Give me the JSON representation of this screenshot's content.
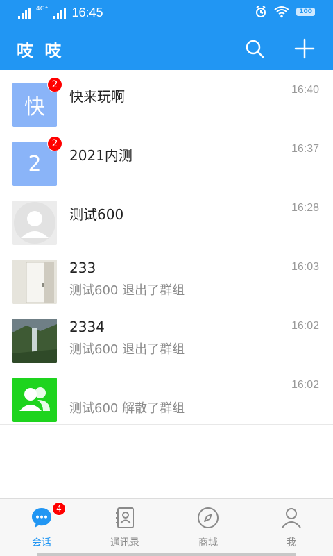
{
  "status": {
    "time": "16:45",
    "network_label": "4G⁺",
    "battery": "100"
  },
  "header": {
    "title": "吱 吱",
    "search_icon": "search-icon",
    "add_icon": "plus-icon"
  },
  "chats": [
    {
      "avatar_text": "快",
      "avatar_color": "#8ab4f8",
      "badge": "2",
      "name": "快来玩啊",
      "subtitle": "",
      "time": "16:40"
    },
    {
      "avatar_text": "2",
      "avatar_color": "#8ab4f8",
      "badge": "2",
      "name": "2021内测",
      "subtitle": "",
      "time": "16:37"
    },
    {
      "avatar_text": "",
      "avatar_color": "#e8e8e8",
      "badge": "",
      "name": "测试600",
      "subtitle": "",
      "time": "16:28"
    },
    {
      "avatar_text": "",
      "avatar_color": "#d8d8d0",
      "badge": "",
      "name": "233",
      "subtitle": "测试600 退出了群组",
      "time": "16:03"
    },
    {
      "avatar_text": "",
      "avatar_color": "#3a4a3a",
      "badge": "",
      "name": "2334",
      "subtitle": "测试600 退出了群组",
      "time": "16:02"
    },
    {
      "avatar_text": "",
      "avatar_color": "#1ed41e",
      "badge": "",
      "name": "",
      "subtitle": "测试600 解散了群组",
      "time": "16:02"
    }
  ],
  "tabs": [
    {
      "label": "会话",
      "icon": "chat-icon",
      "badge": "4"
    },
    {
      "label": "通讯录",
      "icon": "contacts-icon",
      "badge": ""
    },
    {
      "label": "商城",
      "icon": "compass-icon",
      "badge": ""
    },
    {
      "label": "我",
      "icon": "profile-icon",
      "badge": ""
    }
  ],
  "colors": {
    "accent": "#2196f3",
    "badge": "#ff0000",
    "group_avatar": "#1ed41e"
  }
}
